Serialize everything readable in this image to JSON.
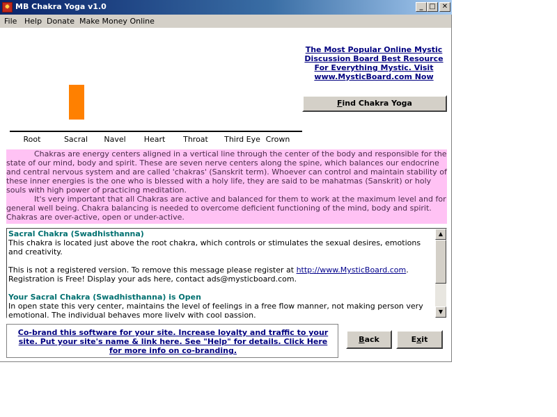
{
  "window": {
    "title": "MB Chakra Yoga v1.0",
    "controls": {
      "minimize": "_",
      "maximize": "□",
      "close": "✕"
    }
  },
  "menu": {
    "items": [
      "File",
      "Help",
      "Donate",
      "Make Money Online"
    ]
  },
  "chart_data": {
    "type": "bar",
    "categories": [
      "Root",
      "Sacral",
      "Navel",
      "Heart",
      "Throat",
      "Third Eye",
      "Crown"
    ],
    "values": [
      0,
      1,
      0,
      0,
      0,
      0,
      0
    ],
    "colors": {
      "Sacral": "#ff8000"
    }
  },
  "ad": {
    "text": "The Most Popular Online Mystic Discussion Board Best Resource For Everything Mystic. Visit www.MysticBoard.com Now"
  },
  "buttons": {
    "find": {
      "accel": "F",
      "rest": "ind Chakra Yoga"
    },
    "back": {
      "accel": "B",
      "rest": "ack"
    },
    "exit": {
      "pre": "E",
      "accel": "x",
      "rest": "it"
    }
  },
  "description": {
    "p1": "Chakras are energy centers aligned in a vertical line through the center of the body and responsible for the state of our mind, body and spirit. These are seven nerve centers along the spine, which balances our endocrine and central nervous system and are called 'chakras' (Sanskrit term). Whoever can control and maintain stability of these inner energies is the one who is blessed with a holy life, they are said to be mahatmas (Sanskrit) or holy souls with high power of practicing meditation.",
    "p2": "It's very important that all Chakras are active and balanced for them to work at the maximum level and for general well being. Chakra balancing is needed to overcome deficient functioning of the mind, body and spirit. Chakras are over-active, open or under-active.",
    "bg_color": "#ffc2f4"
  },
  "details": {
    "heading1": "Sacral Chakra (Swadhisthanna)",
    "body1": "This chakra is located just above the root chakra, which controls or stimulates the sexual desires, emotions and creativity.",
    "reg_pre": "This is not a registered version. To remove this message please register at ",
    "reg_link": "http://www.MysticBoard.com",
    "reg_post": ". Registration is Free! Display your ads here, contact ads@mysticboard.com.",
    "heading2": "Your Sacral Chakra (Swadhisthanna) is Open",
    "body2": "In open state this very center, maintains the level of feelings in a free flow manner, not making person very emotional. The individual behaves more lively with cool passion."
  },
  "cobrand": {
    "text": "Co-brand this software for your site.  Increase loyalty and traffic to your site. Put your site's name &  link here. See \"Help\" for details. Click Here for more info on co-branding."
  }
}
